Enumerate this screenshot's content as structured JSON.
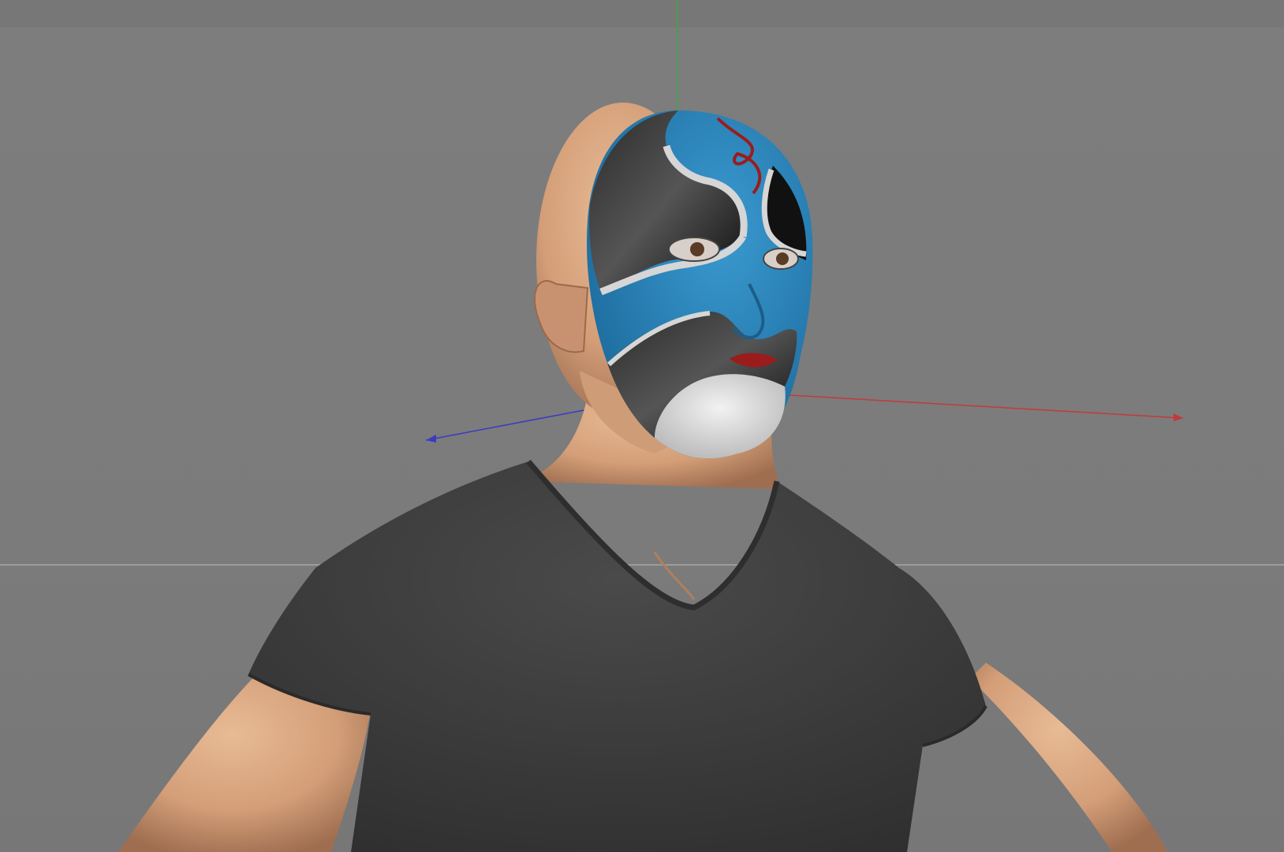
{
  "viewport": {
    "mode": "3d-perspective",
    "background_color": "#7a7a7a",
    "horizon_grid_visible": true
  },
  "axes": {
    "x_axis_color": "#c43a3a",
    "y_axis_color": "#3aa84a",
    "z_axis_color": "#3a3ac4"
  },
  "scene": {
    "figure": "male-character",
    "mask_style": "peking-opera-face-mask",
    "colors": {
      "mask_blue": "#2a7fb5",
      "mask_black": "#111111",
      "mask_white": "#e6e6e6",
      "mask_red": "#9b1c1c",
      "skin": "#d9a882",
      "shirt": "#3f3f3f"
    }
  }
}
